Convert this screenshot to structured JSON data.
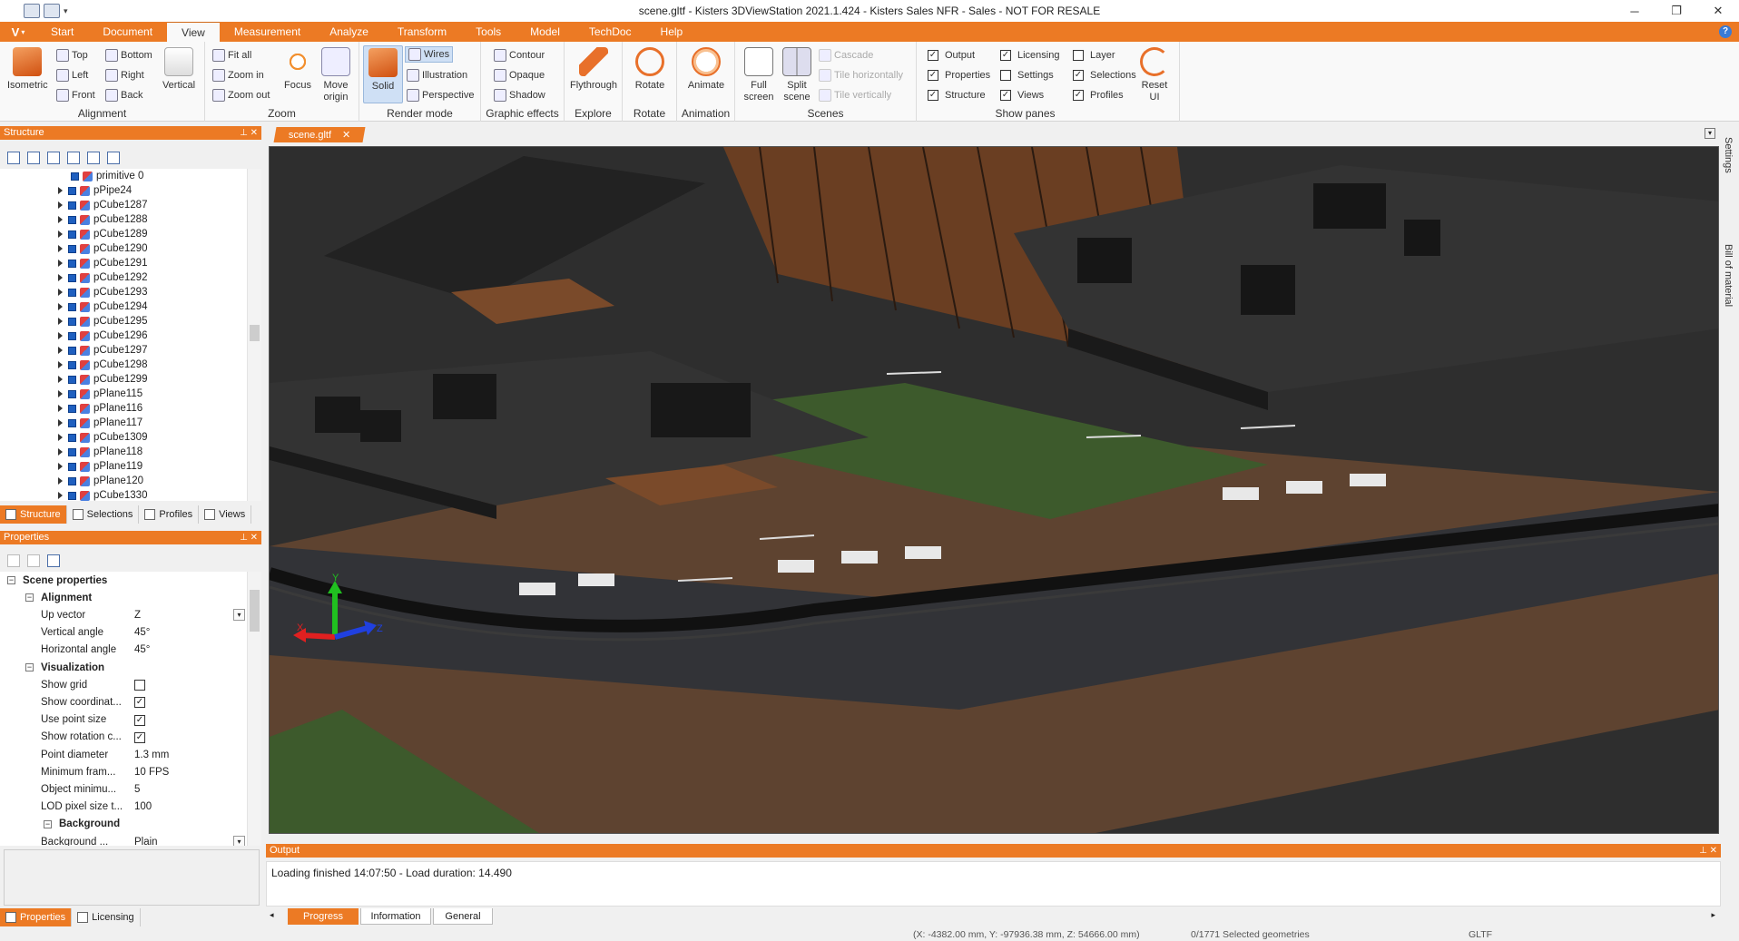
{
  "window": {
    "title": "scene.gltf - Kisters 3DViewStation 2021.1.424 - Kisters Sales NFR - Sales - NOT FOR RESALE",
    "controls": [
      "─",
      "❐",
      "✕"
    ]
  },
  "app_button": "V",
  "ribbon_tabs": [
    "Start",
    "Document",
    "View",
    "Measurement",
    "Analyze",
    "Transform",
    "Tools",
    "Model",
    "TechDoc",
    "Help"
  ],
  "ribbon": {
    "alignment": {
      "label": "Alignment",
      "isometric": "Isometric",
      "top": "Top",
      "left": "Left",
      "front": "Front",
      "bottom": "Bottom",
      "right": "Right",
      "back": "Back",
      "vertical": "Vertical"
    },
    "zoom": {
      "label": "Zoom",
      "fit_all": "Fit all",
      "zoom_in": "Zoom in",
      "zoom_out": "Zoom out",
      "focus": "Focus",
      "move_origin_1": "Move",
      "move_origin_2": "origin"
    },
    "render_mode": {
      "label": "Render mode",
      "solid": "Solid",
      "wires": "Wires",
      "illustration": "Illustration",
      "perspective": "Perspective"
    },
    "graphic_effects": {
      "label": "Graphic effects",
      "contour": "Contour",
      "opaque": "Opaque",
      "shadow": "Shadow"
    },
    "explore": {
      "label": "Explore",
      "flythrough": "Flythrough"
    },
    "rotate": {
      "label": "Rotate",
      "rotate": "Rotate"
    },
    "animation": {
      "label": "Animation",
      "animate": "Animate"
    },
    "scenes": {
      "label": "Scenes",
      "full_1": "Full",
      "full_2": "screen",
      "split_1": "Split",
      "split_2": "scene",
      "cascade": "Cascade",
      "tile_h": "Tile horizontally",
      "tile_v": "Tile vertically"
    },
    "show_panes": {
      "label": "Show panes",
      "items": [
        {
          "label": "Output",
          "checked": true
        },
        {
          "label": "Properties",
          "checked": true
        },
        {
          "label": "Structure",
          "checked": true
        },
        {
          "label": "Licensing",
          "checked": true
        },
        {
          "label": "Settings",
          "checked": false
        },
        {
          "label": "Views",
          "checked": true
        },
        {
          "label": "Layer",
          "checked": false
        },
        {
          "label": "Selections",
          "checked": true
        },
        {
          "label": "Profiles",
          "checked": true
        }
      ],
      "reset_1": "Reset",
      "reset_2": "UI"
    }
  },
  "structure": {
    "title": "Structure",
    "items": [
      "primitive 0",
      "pPipe24",
      "pCube1287",
      "pCube1288",
      "pCube1289",
      "pCube1290",
      "pCube1291",
      "pCube1292",
      "pCube1293",
      "pCube1294",
      "pCube1295",
      "pCube1296",
      "pCube1297",
      "pCube1298",
      "pCube1299",
      "pPlane115",
      "pPlane116",
      "pPlane117",
      "pCube1309",
      "pPlane118",
      "pPlane119",
      "pPlane120",
      "pCube1330"
    ],
    "tabs": [
      "Structure",
      "Selections",
      "Profiles",
      "Views"
    ]
  },
  "properties": {
    "title": "Properties",
    "rows": [
      {
        "type": "cat",
        "level": 0,
        "name": "Scene properties"
      },
      {
        "type": "cat",
        "level": 1,
        "name": "Alignment"
      },
      {
        "type": "prop",
        "name": "Up vector",
        "value": "Z",
        "dropdown": true
      },
      {
        "type": "prop",
        "name": "Vertical angle",
        "value": "45°"
      },
      {
        "type": "prop",
        "name": "Horizontal angle",
        "value": "45°"
      },
      {
        "type": "cat",
        "level": 1,
        "name": "Visualization"
      },
      {
        "type": "prop",
        "name": "Show grid",
        "check": false
      },
      {
        "type": "prop",
        "name": "Show coordinat...",
        "check": true
      },
      {
        "type": "prop",
        "name": "Use point size",
        "check": true
      },
      {
        "type": "prop",
        "name": "Show rotation c...",
        "check": true
      },
      {
        "type": "prop",
        "name": "Point diameter",
        "value": "1.3 mm"
      },
      {
        "type": "prop",
        "name": "Minimum fram...",
        "value": "10 FPS"
      },
      {
        "type": "prop",
        "name": "Object minimu...",
        "value": "5"
      },
      {
        "type": "prop",
        "name": "LOD pixel size t...",
        "value": "100"
      },
      {
        "type": "cat",
        "level": 2,
        "name": "Background"
      },
      {
        "type": "prop",
        "name": "Background ...",
        "value": "Plain",
        "dropdown": true
      }
    ],
    "tabs": [
      "Properties",
      "Licensing"
    ]
  },
  "document_tab": "scene.gltf",
  "side_panes": [
    "Settings",
    "Bill of material"
  ],
  "viewport": {
    "axes": {
      "x": "X",
      "y": "Y",
      "z": "Z"
    },
    "colors": {
      "sky": "#2e2e2e",
      "floor": "#6b4a32",
      "grass": "#3d5a2c",
      "roof": "#303030",
      "wood": "#7a4a2a",
      "x_axis": "#e02020",
      "y_axis": "#20c020",
      "z_axis": "#2040e0"
    }
  },
  "output": {
    "title": "Output",
    "message": "Loading finished 14:07:50 - Load duration: 14.490",
    "tabs": [
      "Progress",
      "Information",
      "General"
    ]
  },
  "status": {
    "coords": "(X: -4382.00 mm, Y: -97936.38 mm, Z: 54666.00 mm)",
    "selected": "0/1771 Selected geometries",
    "format": "GLTF"
  },
  "accent_color": "#ec7a24"
}
